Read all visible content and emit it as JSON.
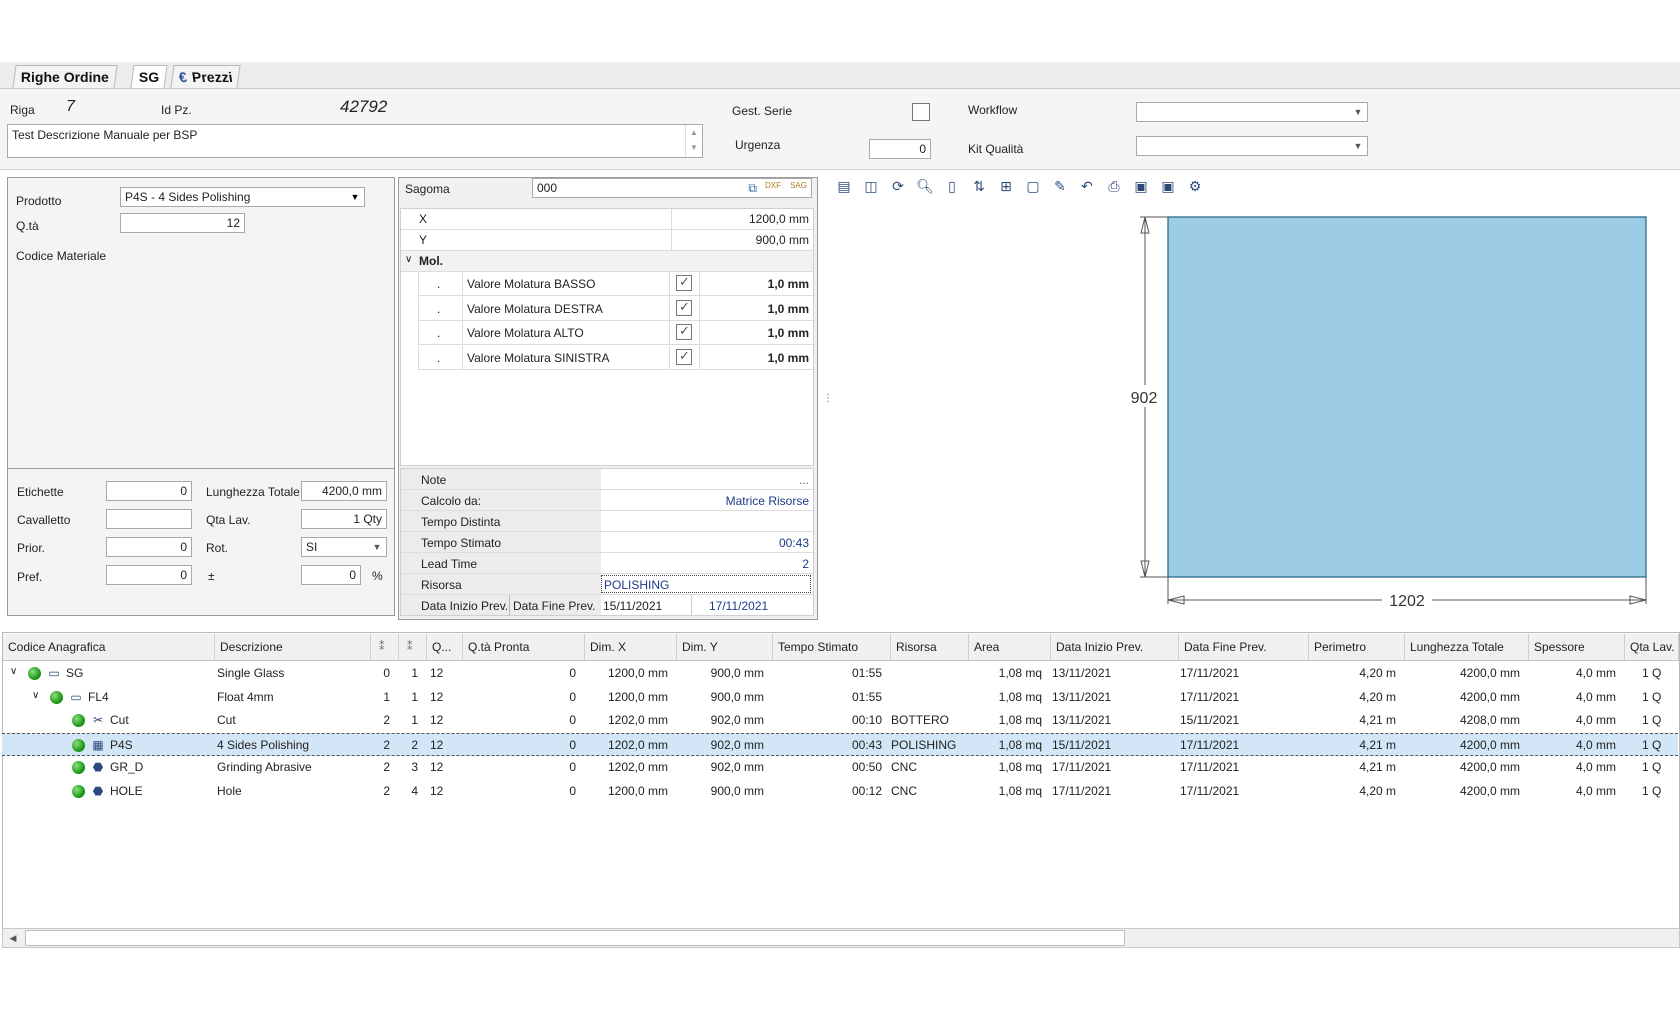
{
  "tabs": [
    {
      "label": "Righe Ordine"
    },
    {
      "label": "SG"
    },
    {
      "label": "Prezzi",
      "icon": "euro-icon"
    }
  ],
  "header": {
    "riga_label": "Riga",
    "riga_value": "7",
    "idpz_label": "Id Pz.",
    "idpz_value": "42792",
    "description": "Test Descrizione Manuale per BSP",
    "gest_serie_label": "Gest. Serie",
    "urgenza_label": "Urgenza",
    "urgenza_value": "0",
    "workflow_label": "Workflow",
    "kit_qualita_label": "Kit Qualità"
  },
  "product": {
    "prodotto_label": "Prodotto",
    "prodotto_value": "P4S - 4 Sides Polishing",
    "qta_label": "Q.tà",
    "qta_value": "12",
    "codice_materiale_label": "Codice Materiale"
  },
  "extra": {
    "etichette_label": "Etichette",
    "etichette_value": "0",
    "lunghezza_label": "Lunghezza Totale",
    "lunghezza_value": "4200,0 mm",
    "cavalletto_label": "Cavalletto",
    "cavalletto_value": "",
    "qta_lav_label": "Qta Lav.",
    "qta_lav_value": "1 Qty",
    "prior_label": "Prior.",
    "prior_value": "0",
    "rot_label": "Rot.",
    "rot_value": "SI",
    "pref_label": "Pref.",
    "pref_value": "0",
    "pm_label": "±",
    "pm_value": "0",
    "pct_label": "%"
  },
  "sagoma": {
    "label": "Sagoma",
    "value": "000",
    "x_label": "X",
    "x_value": "1200,0 mm",
    "y_label": "Y",
    "y_value": "900,0 mm",
    "mol_label": "Mol.",
    "mol_rows": [
      {
        "dot": ".",
        "label": "Valore Molatura BASSO",
        "value": "1,0 mm"
      },
      {
        "dot": ".",
        "label": "Valore Molatura DESTRA",
        "value": "1,0 mm"
      },
      {
        "dot": ".",
        "label": "Valore Molatura ALTO",
        "value": "1,0 mm"
      },
      {
        "dot": ".",
        "label": "Valore Molatura SINISTRA",
        "value": "1,0 mm"
      }
    ]
  },
  "info": {
    "note_label": "Note",
    "note_value": "...",
    "calcolo_label": "Calcolo da:",
    "calcolo_value": "Matrice Risorse",
    "tempo_distinta_label": "Tempo Distinta",
    "tempo_distinta_value": "",
    "tempo_stimato_label": "Tempo Stimato",
    "tempo_stimato_value": "00:43",
    "lead_time_label": "Lead Time",
    "lead_time_value": "2",
    "risorsa_label": "Risorsa",
    "risorsa_value": "POLISHING",
    "data_inizio_label": "Data Inizio Prev.",
    "data_fine_label": "Data Fine Prev.",
    "data_inizio_value": "15/11/2021",
    "data_fine_value": "17/11/2021"
  },
  "drawing": {
    "height_label": "902",
    "width_label": "1202",
    "fill_color": "#9ccde4"
  },
  "grid": {
    "columns": [
      "Codice Anagrafica",
      "Descrizione",
      "",
      "",
      "Q...",
      "Q.tà Pronta",
      "Dim. X",
      "Dim. Y",
      "Tempo Stimato",
      "Risorsa",
      "Area",
      "Data Inizio Prev.",
      "Data Fine Prev.",
      "Perimetro",
      "Lunghezza Totale",
      "Spessore",
      "Qta Lav."
    ],
    "rows": [
      {
        "code": "SG",
        "desc": "Single Glass",
        "a": "0",
        "b": "1",
        "q": "12",
        "pronta": "0",
        "dx": "1200,0 mm",
        "dy": "900,0 mm",
        "tempo": "01:55",
        "risorsa": "",
        "area": "1,08 mq",
        "inizio": "13/11/2021",
        "fine": "17/11/2021",
        "perim": "4,20 m",
        "lung": "4200,0 mm",
        "spess": "4,0 mm",
        "qtalav": "1 Q"
      },
      {
        "code": "FL4",
        "desc": "Float 4mm",
        "a": "1",
        "b": "1",
        "q": "12",
        "pronta": "0",
        "dx": "1200,0 mm",
        "dy": "900,0 mm",
        "tempo": "01:55",
        "risorsa": "",
        "area": "1,08 mq",
        "inizio": "13/11/2021",
        "fine": "17/11/2021",
        "perim": "4,20 m",
        "lung": "4200,0 mm",
        "spess": "4,0 mm",
        "qtalav": "1 Q"
      },
      {
        "code": "Cut",
        "desc": "Cut",
        "a": "2",
        "b": "1",
        "q": "12",
        "pronta": "0",
        "dx": "1202,0 mm",
        "dy": "902,0 mm",
        "tempo": "00:10",
        "risorsa": "BOTTERO",
        "area": "1,08 mq",
        "inizio": "13/11/2021",
        "fine": "15/11/2021",
        "perim": "4,21 m",
        "lung": "4208,0 mm",
        "spess": "4,0 mm",
        "qtalav": "1 Q"
      },
      {
        "code": "P4S",
        "desc": "4 Sides Polishing",
        "a": "2",
        "b": "2",
        "q": "12",
        "pronta": "0",
        "dx": "1202,0 mm",
        "dy": "902,0 mm",
        "tempo": "00:43",
        "risorsa": "POLISHING",
        "area": "1,08 mq",
        "inizio": "15/11/2021",
        "fine": "17/11/2021",
        "perim": "4,21 m",
        "lung": "4200,0 mm",
        "spess": "4,0 mm",
        "qtalav": "1 Q"
      },
      {
        "code": "GR_D",
        "desc": "Grinding Abrasive",
        "a": "2",
        "b": "3",
        "q": "12",
        "pronta": "0",
        "dx": "1202,0 mm",
        "dy": "902,0 mm",
        "tempo": "00:50",
        "risorsa": "CNC",
        "area": "1,08 mq",
        "inizio": "17/11/2021",
        "fine": "17/11/2021",
        "perim": "4,21 m",
        "lung": "4200,0 mm",
        "spess": "4,0 mm",
        "qtalav": "1 Q"
      },
      {
        "code": "HOLE",
        "desc": "Hole",
        "a": "2",
        "b": "4",
        "q": "12",
        "pronta": "0",
        "dx": "1200,0 mm",
        "dy": "900,0 mm",
        "tempo": "00:12",
        "risorsa": "CNC",
        "area": "1,08 mq",
        "inizio": "17/11/2021",
        "fine": "17/11/2021",
        "perim": "4,20 m",
        "lung": "4200,0 mm",
        "spess": "4,0 mm",
        "qtalav": "1 Q"
      }
    ]
  }
}
